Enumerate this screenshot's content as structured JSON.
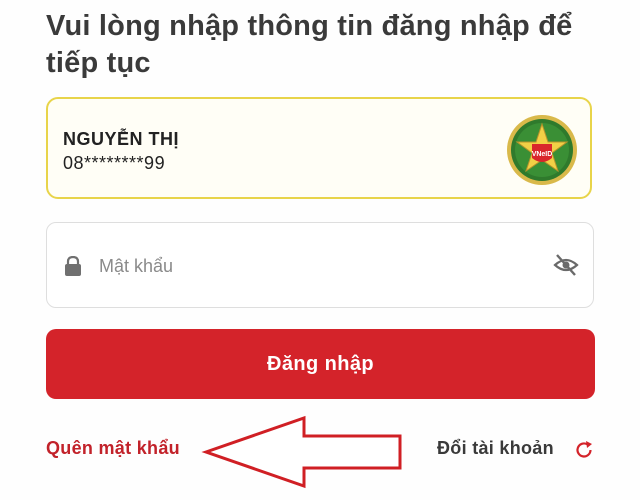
{
  "header": {
    "title": "Vui lòng nhập thông tin đăng nhập để tiếp tục"
  },
  "account": {
    "name": "NGUYỄN THỊ",
    "phone": "08********99",
    "badge_icon": "vneid-emblem-icon",
    "badge_text": "VNeID"
  },
  "password": {
    "placeholder": "Mật khẩu",
    "value": "",
    "lock_icon": "lock-icon",
    "toggle_icon": "eye-slash-icon"
  },
  "actions": {
    "login_label": "Đăng nhập",
    "forgot_label": "Quên mật khẩu",
    "switch_label": "Đổi tài khoản",
    "switch_icon": "refresh-icon"
  },
  "colors": {
    "primary_red": "#d4232a",
    "link_red": "#c2222a",
    "card_border": "#e8d44a",
    "annotation_arrow": "#d01f24"
  }
}
